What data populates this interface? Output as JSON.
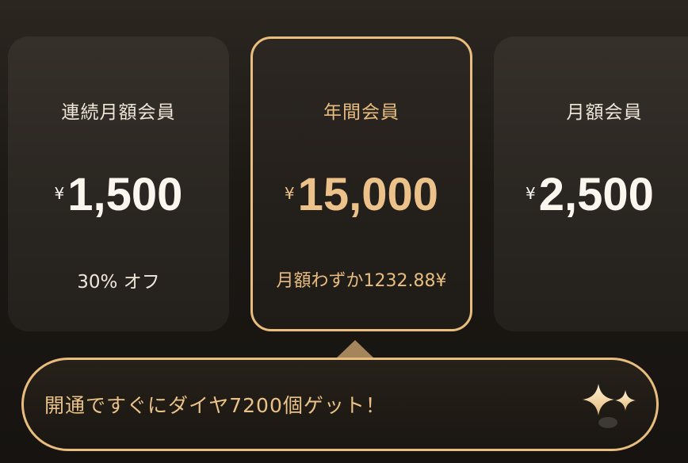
{
  "plans": [
    {
      "title": "連続月額会員",
      "currency": "¥",
      "price": "1,500",
      "note": "30% オフ",
      "selected": false
    },
    {
      "title": "年間会員",
      "currency": "¥",
      "price": "15,000",
      "note": "月額わずか1232.88¥",
      "selected": true
    },
    {
      "title": "月額会員",
      "currency": "¥",
      "price": "2,500",
      "note": "",
      "selected": false
    }
  ],
  "banner": {
    "text": "開通ですぐにダイヤ7200個ゲット！",
    "icon": "sparkle-icon"
  },
  "colors": {
    "accent_gold": "#e8bd7e",
    "price_white": "#fbf7ef",
    "card_bg": "#2a2621"
  }
}
